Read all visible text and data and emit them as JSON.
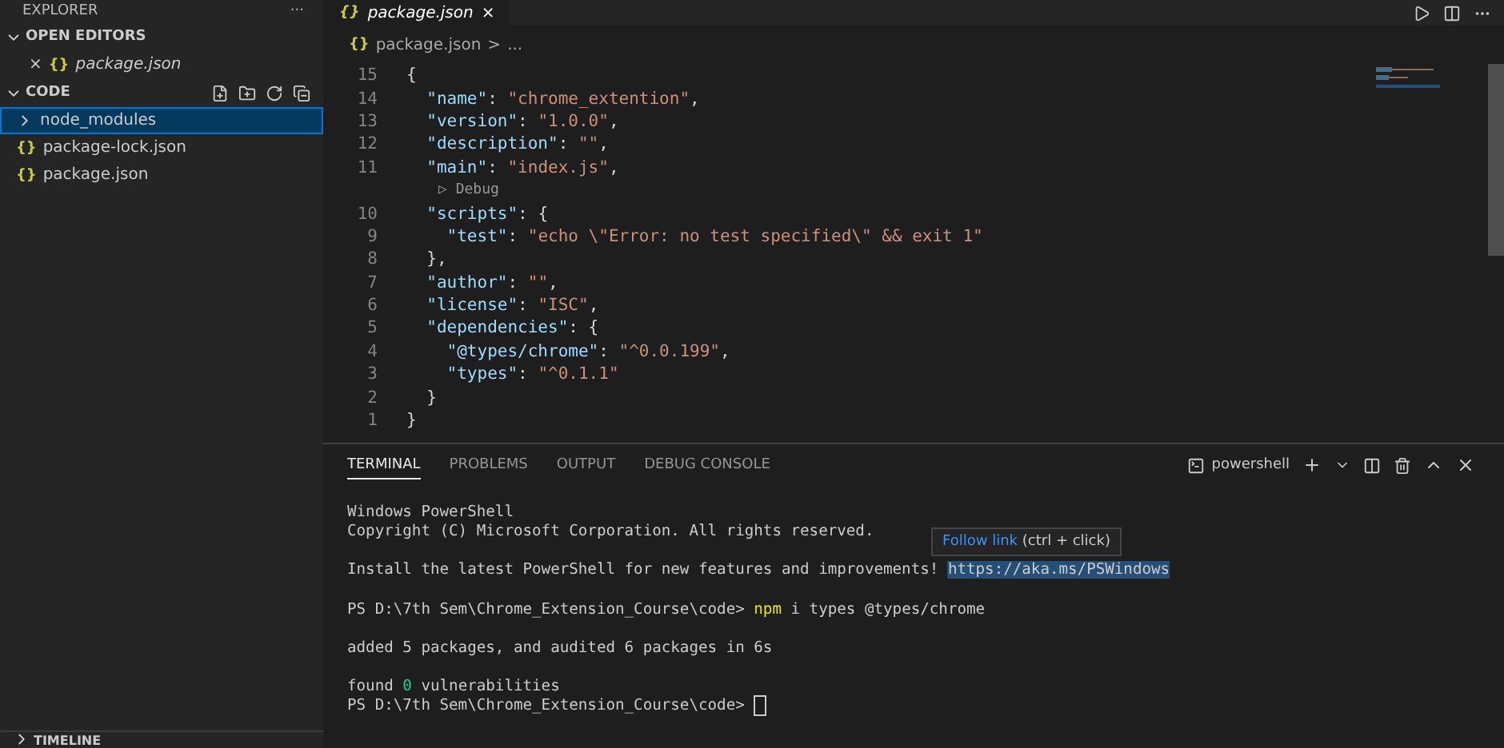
{
  "sidebar": {
    "title": "EXPLORER",
    "more": "···",
    "open_editors": {
      "label": "OPEN EDITORS",
      "expanded": true,
      "items": [
        {
          "close": "×",
          "icon": "{}",
          "name": "package.json",
          "italic": true
        }
      ]
    },
    "folder": {
      "label": "CODE",
      "expanded": true,
      "items": [
        {
          "kind": "folder",
          "name": "node_modules",
          "selected": true,
          "expanded": false
        },
        {
          "kind": "file",
          "icon": "{}",
          "name": "package-lock.json",
          "selected": false
        },
        {
          "kind": "file",
          "icon": "{}",
          "name": "package.json",
          "selected": false
        }
      ]
    },
    "timeline": {
      "label": "TIMELINE",
      "expanded": false
    }
  },
  "editor": {
    "tabs": [
      {
        "icon": "{}",
        "label": "package.json",
        "close": "×",
        "selected": true
      }
    ],
    "breadcrumb": {
      "icon": "{}",
      "file": "package.json",
      "sep": ">",
      "rest": "..."
    },
    "lines": [
      {
        "number": "15",
        "tokens": [
          {
            "kind": "punct",
            "text": "{"
          }
        ]
      },
      {
        "number": "14",
        "tokens": [
          {
            "kind": "key",
            "text": "  \"name\""
          },
          {
            "kind": "punct",
            "text": ": "
          },
          {
            "kind": "string",
            "text": "\"chrome_extention\""
          },
          {
            "kind": "punct",
            "text": ","
          }
        ]
      },
      {
        "number": "13",
        "tokens": [
          {
            "kind": "key",
            "text": "  \"version\""
          },
          {
            "kind": "punct",
            "text": ": "
          },
          {
            "kind": "string",
            "text": "\"1.0.0\""
          },
          {
            "kind": "punct",
            "text": ","
          }
        ]
      },
      {
        "number": "12",
        "tokens": [
          {
            "kind": "key",
            "text": "  \"description\""
          },
          {
            "kind": "punct",
            "text": ": "
          },
          {
            "kind": "string",
            "text": "\"\""
          },
          {
            "kind": "punct",
            "text": ","
          }
        ]
      },
      {
        "number": "11",
        "tokens": [
          {
            "kind": "key",
            "text": "  \"main\""
          },
          {
            "kind": "punct",
            "text": ": "
          },
          {
            "kind": "string",
            "text": "\"index.js\""
          },
          {
            "kind": "punct",
            "text": ","
          }
        ]
      },
      {
        "kind": "lens",
        "icon": "▷",
        "label": "Debug"
      },
      {
        "number": "10",
        "tokens": [
          {
            "kind": "key",
            "text": "  \"scripts\""
          },
          {
            "kind": "punct",
            "text": ": {"
          }
        ]
      },
      {
        "number": "9",
        "tokens": [
          {
            "kind": "key",
            "text": "    \"test\""
          },
          {
            "kind": "punct",
            "text": ": "
          },
          {
            "kind": "string",
            "text": "\"echo \\\"Error: no test specified\\\" && exit 1\""
          }
        ]
      },
      {
        "number": "8",
        "tokens": [
          {
            "kind": "punct",
            "text": "  },"
          }
        ]
      },
      {
        "number": "7",
        "tokens": [
          {
            "kind": "key",
            "text": "  \"author\""
          },
          {
            "kind": "punct",
            "text": ": "
          },
          {
            "kind": "string",
            "text": "\"\""
          },
          {
            "kind": "punct",
            "text": ","
          }
        ]
      },
      {
        "number": "6",
        "tokens": [
          {
            "kind": "key",
            "text": "  \"license\""
          },
          {
            "kind": "punct",
            "text": ": "
          },
          {
            "kind": "string",
            "text": "\"ISC\""
          },
          {
            "kind": "punct",
            "text": ","
          }
        ]
      },
      {
        "number": "5",
        "tokens": [
          {
            "kind": "key",
            "text": "  \"dependencies\""
          },
          {
            "kind": "punct",
            "text": ": {"
          }
        ]
      },
      {
        "number": "4",
        "tokens": [
          {
            "kind": "key",
            "text": "    \"@types/chrome\""
          },
          {
            "kind": "punct",
            "text": ": "
          },
          {
            "kind": "string",
            "text": "\"^0.0.199\""
          },
          {
            "kind": "punct",
            "text": ","
          }
        ]
      },
      {
        "number": "3",
        "tokens": [
          {
            "kind": "key",
            "text": "    \"types\""
          },
          {
            "kind": "punct",
            "text": ": "
          },
          {
            "kind": "string",
            "text": "\"^0.1.1\""
          }
        ]
      },
      {
        "number": "2",
        "tokens": [
          {
            "kind": "punct",
            "text": "  }"
          }
        ]
      },
      {
        "number": "1",
        "tokens": [
          {
            "kind": "punct",
            "text": "}"
          }
        ]
      }
    ]
  },
  "panel": {
    "tabs": [
      {
        "label": "TERMINAL",
        "selected": true
      },
      {
        "label": "PROBLEMS",
        "selected": false
      },
      {
        "label": "OUTPUT",
        "selected": false
      },
      {
        "label": "DEBUG CONSOLE",
        "selected": false
      }
    ],
    "shell": "powershell",
    "tooltip": {
      "link": "Follow link",
      "hint": "(ctrl + click)"
    },
    "lines": [
      {
        "kind": "output",
        "tokens": [
          {
            "kind": "text",
            "text": "Windows PowerShell"
          }
        ]
      },
      {
        "kind": "output",
        "tokens": [
          {
            "kind": "text",
            "text": "Copyright (C) Microsoft Corporation. All rights reserved."
          }
        ]
      },
      {
        "kind": "blank"
      },
      {
        "kind": "output",
        "tokens": [
          {
            "kind": "text",
            "text": "Install the latest PowerShell for new features and improvements! "
          },
          {
            "kind": "link",
            "text": "https://aka.ms/PSWindows"
          }
        ]
      },
      {
        "kind": "blank"
      },
      {
        "kind": "output",
        "tokens": [
          {
            "kind": "text",
            "text": "PS D:\\7th Sem\\Chrome_Extension_Course\\code> "
          },
          {
            "kind": "command",
            "text": "npm"
          },
          {
            "kind": "text",
            "text": " i types @types/chrome"
          }
        ]
      },
      {
        "kind": "blank"
      },
      {
        "kind": "output",
        "tokens": [
          {
            "kind": "text",
            "text": "added 5 packages, and audited 6 packages in 6s"
          }
        ]
      },
      {
        "kind": "blank"
      },
      {
        "kind": "output",
        "tokens": [
          {
            "kind": "text",
            "text": "found "
          },
          {
            "kind": "number",
            "text": "0"
          },
          {
            "kind": "text",
            "text": " vulnerabilities"
          }
        ]
      },
      {
        "kind": "output",
        "tokens": [
          {
            "kind": "text",
            "text": "PS D:\\7th Sem\\Chrome_Extension_Course\\code> "
          },
          {
            "kind": "cursor"
          }
        ]
      }
    ]
  }
}
